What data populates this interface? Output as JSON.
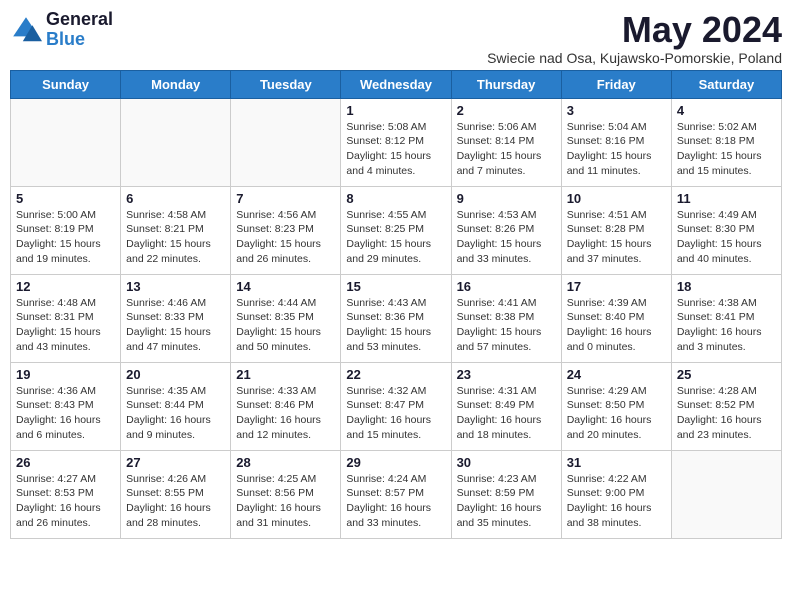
{
  "header": {
    "logo_general": "General",
    "logo_blue": "Blue",
    "month_title": "May 2024",
    "subtitle": "Swiecie nad Osa, Kujawsko-Pomorskie, Poland"
  },
  "weekdays": [
    "Sunday",
    "Monday",
    "Tuesday",
    "Wednesday",
    "Thursday",
    "Friday",
    "Saturday"
  ],
  "weeks": [
    [
      {
        "day": "",
        "info": ""
      },
      {
        "day": "",
        "info": ""
      },
      {
        "day": "",
        "info": ""
      },
      {
        "day": "1",
        "info": "Sunrise: 5:08 AM\nSunset: 8:12 PM\nDaylight: 15 hours\nand 4 minutes."
      },
      {
        "day": "2",
        "info": "Sunrise: 5:06 AM\nSunset: 8:14 PM\nDaylight: 15 hours\nand 7 minutes."
      },
      {
        "day": "3",
        "info": "Sunrise: 5:04 AM\nSunset: 8:16 PM\nDaylight: 15 hours\nand 11 minutes."
      },
      {
        "day": "4",
        "info": "Sunrise: 5:02 AM\nSunset: 8:18 PM\nDaylight: 15 hours\nand 15 minutes."
      }
    ],
    [
      {
        "day": "5",
        "info": "Sunrise: 5:00 AM\nSunset: 8:19 PM\nDaylight: 15 hours\nand 19 minutes."
      },
      {
        "day": "6",
        "info": "Sunrise: 4:58 AM\nSunset: 8:21 PM\nDaylight: 15 hours\nand 22 minutes."
      },
      {
        "day": "7",
        "info": "Sunrise: 4:56 AM\nSunset: 8:23 PM\nDaylight: 15 hours\nand 26 minutes."
      },
      {
        "day": "8",
        "info": "Sunrise: 4:55 AM\nSunset: 8:25 PM\nDaylight: 15 hours\nand 29 minutes."
      },
      {
        "day": "9",
        "info": "Sunrise: 4:53 AM\nSunset: 8:26 PM\nDaylight: 15 hours\nand 33 minutes."
      },
      {
        "day": "10",
        "info": "Sunrise: 4:51 AM\nSunset: 8:28 PM\nDaylight: 15 hours\nand 37 minutes."
      },
      {
        "day": "11",
        "info": "Sunrise: 4:49 AM\nSunset: 8:30 PM\nDaylight: 15 hours\nand 40 minutes."
      }
    ],
    [
      {
        "day": "12",
        "info": "Sunrise: 4:48 AM\nSunset: 8:31 PM\nDaylight: 15 hours\nand 43 minutes."
      },
      {
        "day": "13",
        "info": "Sunrise: 4:46 AM\nSunset: 8:33 PM\nDaylight: 15 hours\nand 47 minutes."
      },
      {
        "day": "14",
        "info": "Sunrise: 4:44 AM\nSunset: 8:35 PM\nDaylight: 15 hours\nand 50 minutes."
      },
      {
        "day": "15",
        "info": "Sunrise: 4:43 AM\nSunset: 8:36 PM\nDaylight: 15 hours\nand 53 minutes."
      },
      {
        "day": "16",
        "info": "Sunrise: 4:41 AM\nSunset: 8:38 PM\nDaylight: 15 hours\nand 57 minutes."
      },
      {
        "day": "17",
        "info": "Sunrise: 4:39 AM\nSunset: 8:40 PM\nDaylight: 16 hours\nand 0 minutes."
      },
      {
        "day": "18",
        "info": "Sunrise: 4:38 AM\nSunset: 8:41 PM\nDaylight: 16 hours\nand 3 minutes."
      }
    ],
    [
      {
        "day": "19",
        "info": "Sunrise: 4:36 AM\nSunset: 8:43 PM\nDaylight: 16 hours\nand 6 minutes."
      },
      {
        "day": "20",
        "info": "Sunrise: 4:35 AM\nSunset: 8:44 PM\nDaylight: 16 hours\nand 9 minutes."
      },
      {
        "day": "21",
        "info": "Sunrise: 4:33 AM\nSunset: 8:46 PM\nDaylight: 16 hours\nand 12 minutes."
      },
      {
        "day": "22",
        "info": "Sunrise: 4:32 AM\nSunset: 8:47 PM\nDaylight: 16 hours\nand 15 minutes."
      },
      {
        "day": "23",
        "info": "Sunrise: 4:31 AM\nSunset: 8:49 PM\nDaylight: 16 hours\nand 18 minutes."
      },
      {
        "day": "24",
        "info": "Sunrise: 4:29 AM\nSunset: 8:50 PM\nDaylight: 16 hours\nand 20 minutes."
      },
      {
        "day": "25",
        "info": "Sunrise: 4:28 AM\nSunset: 8:52 PM\nDaylight: 16 hours\nand 23 minutes."
      }
    ],
    [
      {
        "day": "26",
        "info": "Sunrise: 4:27 AM\nSunset: 8:53 PM\nDaylight: 16 hours\nand 26 minutes."
      },
      {
        "day": "27",
        "info": "Sunrise: 4:26 AM\nSunset: 8:55 PM\nDaylight: 16 hours\nand 28 minutes."
      },
      {
        "day": "28",
        "info": "Sunrise: 4:25 AM\nSunset: 8:56 PM\nDaylight: 16 hours\nand 31 minutes."
      },
      {
        "day": "29",
        "info": "Sunrise: 4:24 AM\nSunset: 8:57 PM\nDaylight: 16 hours\nand 33 minutes."
      },
      {
        "day": "30",
        "info": "Sunrise: 4:23 AM\nSunset: 8:59 PM\nDaylight: 16 hours\nand 35 minutes."
      },
      {
        "day": "31",
        "info": "Sunrise: 4:22 AM\nSunset: 9:00 PM\nDaylight: 16 hours\nand 38 minutes."
      },
      {
        "day": "",
        "info": ""
      }
    ]
  ]
}
